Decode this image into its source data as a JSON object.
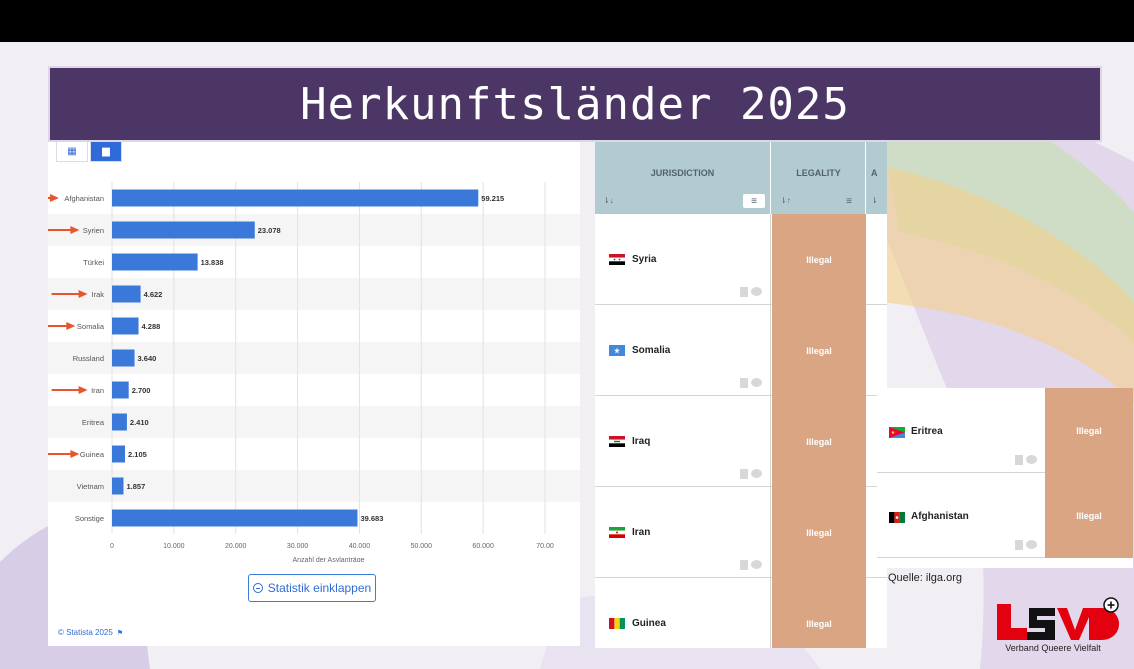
{
  "title": "Herkunftsländer 2025",
  "colors": {
    "title_bg": "#4b3665",
    "bar": "#3a78da",
    "arrow": "#e8552c",
    "illegal_bg": "#d9a583",
    "table_header": "#b2cbd0"
  },
  "statista": {
    "toggle_table_icon": "grid-icon",
    "toggle_chart_icon": "bar-chart-icon",
    "collapse_button": "Statistik einklappen",
    "credit": "© Statista 2025"
  },
  "chart_data": {
    "type": "bar",
    "orientation": "horizontal",
    "categories": [
      "Afghanistan",
      "Syrien",
      "Türkei",
      "Irak",
      "Somalia",
      "Russland",
      "Iran",
      "Eritrea",
      "Guinea",
      "Vietnam",
      "Sonstige"
    ],
    "values": [
      59215,
      23078,
      13838,
      4622,
      4288,
      3640,
      2700,
      2410,
      2105,
      1857,
      39683
    ],
    "value_labels": [
      "59.215",
      "23.078",
      "13.838",
      "4.622",
      "4.288",
      "3.640",
      "2.700",
      "2.410",
      "2.105",
      "1.857",
      "39.683"
    ],
    "highlighted": [
      "Afghanistan",
      "Syrien",
      "Irak",
      "Somalia",
      "Iran",
      "Guinea"
    ],
    "xlabel": "Anzahl der Asylanträge",
    "xlim": [
      0,
      70000
    ],
    "xticks": [
      0,
      10000,
      20000,
      30000,
      40000,
      50000,
      60000,
      70000
    ],
    "xtick_labels": [
      "0",
      "10.000",
      "20.000",
      "30.000",
      "40.000",
      "50.000",
      "60.000",
      "70.00"
    ],
    "grid": true
  },
  "ilga": {
    "headers": [
      "JURISDICTION",
      "LEGALITY"
    ],
    "rows": [
      {
        "country": "Syria",
        "legality": "Illegal"
      },
      {
        "country": "Somalia",
        "legality": "Illegal"
      },
      {
        "country": "Iraq",
        "legality": "Illegal"
      },
      {
        "country": "Iran",
        "legality": "Illegal"
      },
      {
        "country": "Guinea",
        "legality": "Illegal"
      }
    ],
    "overlay_rows": [
      {
        "country": "Eritrea",
        "legality": "Illegal"
      },
      {
        "country": "Afghanistan",
        "legality": "Illegal"
      }
    ],
    "source": "Quelle: ilga.org"
  },
  "logo": {
    "tagline": "Verband Queere Vielfalt"
  }
}
